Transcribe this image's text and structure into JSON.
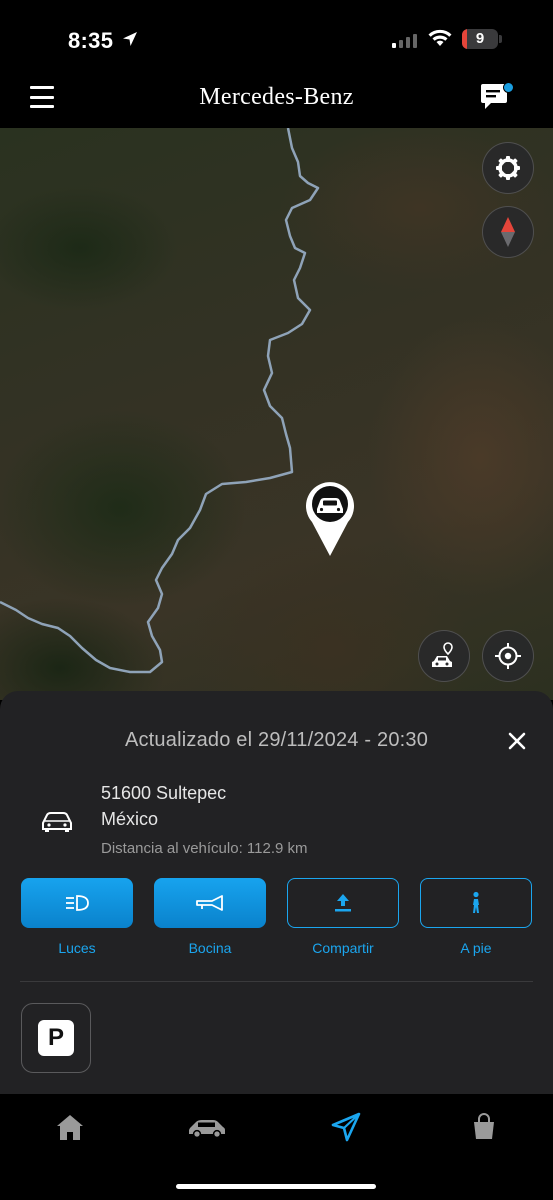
{
  "status_bar": {
    "time": "8:35",
    "battery": "9"
  },
  "header": {
    "brand": "Mercedes-Benz"
  },
  "map": {
    "controls": [
      "gear-icon",
      "compass-icon",
      "car-location-icon",
      "locate-icon"
    ],
    "vehicle_pin": "car-icon"
  },
  "sheet": {
    "updated": "Actualizado el 29/11/2024 - 20:30",
    "address_line1": "51600 Sultepec",
    "address_line2": "México",
    "distance": "Distancia al vehículo: 112.9 km",
    "actions": [
      {
        "label": "Luces",
        "icon": "headlight-icon",
        "style": "filled"
      },
      {
        "label": "Bocina",
        "icon": "horn-icon",
        "style": "filled"
      },
      {
        "label": "Compartir",
        "icon": "share-icon",
        "style": "outline"
      },
      {
        "label": "A pie",
        "icon": "walk-icon",
        "style": "outline"
      }
    ],
    "parking_label": "P"
  },
  "tabbar": {
    "tabs": [
      {
        "name": "home",
        "icon": "home-icon",
        "active": false
      },
      {
        "name": "vehicle",
        "icon": "car-icon",
        "active": false
      },
      {
        "name": "navigation",
        "icon": "navigation-arrow-icon",
        "active": true
      },
      {
        "name": "shop",
        "icon": "shopping-bag-icon",
        "active": false
      }
    ]
  },
  "colors": {
    "accent": "#1ba6ef",
    "sheet": "#222224",
    "background": "#000000",
    "compass_north": "#e5453a"
  }
}
